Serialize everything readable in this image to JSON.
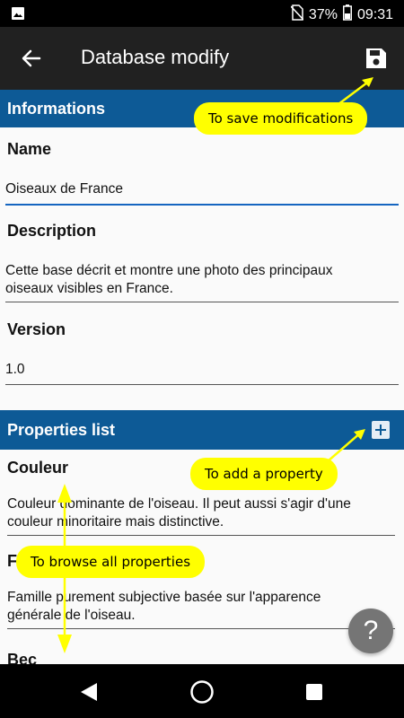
{
  "status_bar": {
    "battery": "37%",
    "time": "09:31"
  },
  "app_bar": {
    "title": "Database modify"
  },
  "sections": {
    "informations": {
      "title": "Informations"
    },
    "properties": {
      "title": "Properties list"
    }
  },
  "fields": {
    "name": {
      "label": "Name",
      "value": "Oiseaux de France"
    },
    "description": {
      "label": "Description",
      "line1": "Cette base décrit et montre une photo des principaux",
      "line2": "oiseaux visibles en France."
    },
    "version": {
      "label": "Version",
      "value": "1.0"
    }
  },
  "properties": [
    {
      "name": "Couleur",
      "line1": "Couleur dominante de l'oiseau. Il peut aussi s'agir d'une",
      "line2": "couleur minoritaire mais distinctive."
    },
    {
      "name": "F",
      "line1": "Famille purement subjective basée sur l'apparence",
      "line2": "générale de l'oiseau."
    },
    {
      "name": "Bec"
    }
  ],
  "tooltips": {
    "save": "To save modifications",
    "add": "To add a property",
    "browse": "To browse all properties"
  },
  "help_label": "?",
  "colors": {
    "section_header": "#0d5a96",
    "tooltip": "#ffff00",
    "app_bar": "#212121",
    "accent_underline": "#1565c0"
  },
  "icons": [
    "image-icon",
    "no-sim-icon",
    "battery-icon",
    "back-arrow-icon",
    "save-icon",
    "add-box-icon",
    "help-icon",
    "nav-back-icon",
    "nav-home-icon",
    "nav-recents-icon"
  ]
}
